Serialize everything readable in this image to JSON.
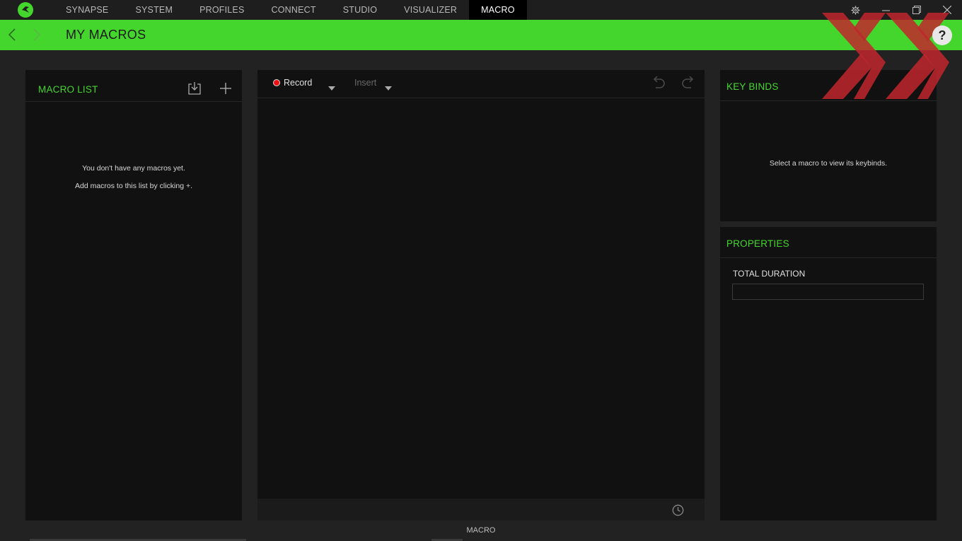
{
  "nav": {
    "items": [
      {
        "label": "SYNAPSE"
      },
      {
        "label": "SYSTEM"
      },
      {
        "label": "PROFILES"
      },
      {
        "label": "CONNECT"
      },
      {
        "label": "STUDIO"
      },
      {
        "label": "VISUALIZER"
      },
      {
        "label": "MACRO"
      }
    ],
    "active": "MACRO"
  },
  "header": {
    "title": "MY MACROS",
    "help_label": "?"
  },
  "macro_list": {
    "title": "MACRO LIST",
    "empty_line1": "You don't have any macros yet.",
    "empty_line2": "Add macros to this list by clicking +."
  },
  "editor": {
    "record_label": "Record",
    "insert_label": "Insert"
  },
  "keybinds": {
    "title": "KEY BINDS",
    "empty_text": "Select a macro to view its keybinds."
  },
  "properties": {
    "title": "PROPERTIES",
    "total_duration_label": "TOTAL DURATION",
    "total_duration_value": ""
  },
  "footer": {
    "label": "MACRO"
  },
  "colors": {
    "accent": "#44d62c",
    "background": "#222222",
    "panel": "#111111",
    "record": "#ee1111"
  },
  "icons": [
    "razer-logo-icon",
    "gear-icon",
    "minimize-icon",
    "restore-icon",
    "close-icon",
    "chevron-left-icon",
    "chevron-right-icon",
    "import-icon",
    "plus-icon",
    "caret-down-icon",
    "undo-icon",
    "redo-icon",
    "clock-icon",
    "help-icon"
  ]
}
